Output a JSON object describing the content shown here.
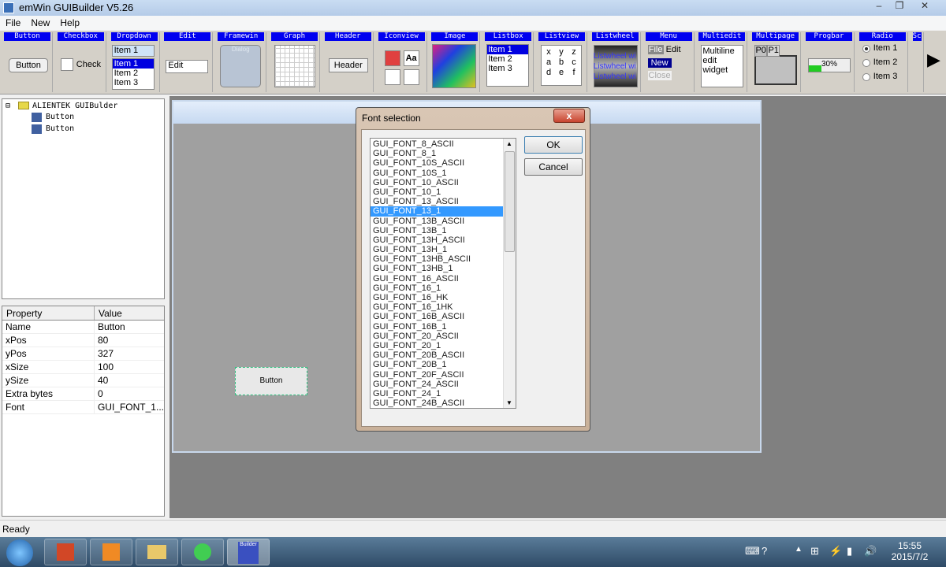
{
  "window": {
    "title": "emWin GUIBuilder V5.26",
    "minimize": "‒",
    "maximize": "❐",
    "close": "✕"
  },
  "menu": [
    "File",
    "New",
    "Help"
  ],
  "toolbar": {
    "tools": [
      "Button",
      "Checkbox",
      "Dropdown",
      "Edit",
      "Framewin",
      "Graph",
      "Header",
      "Iconview",
      "Image",
      "Listbox",
      "Listview",
      "Listwheel",
      "Menu",
      "Multiedit",
      "Multipage",
      "Progbar",
      "Radio",
      "Sc"
    ],
    "button_label": "Button",
    "check_label": "Check",
    "dropdown_selected": "Item 1",
    "dropdown_items": [
      "Item 1",
      "Item 2",
      "Item 3"
    ],
    "edit_value": "Edit",
    "framewin_title": "Dialog",
    "header_label": "Header",
    "iconview_text": "Aa",
    "listbox_items": [
      "Item 1",
      "Item 2",
      "Item 3"
    ],
    "listview_cells": [
      "x",
      "y",
      "z",
      "a",
      "b",
      "c",
      "d",
      "e",
      "f"
    ],
    "listwheel_items": [
      "Listwheel wi",
      "Listwheel wi",
      "Listwheel wi"
    ],
    "menu_items": [
      "File",
      "Edit",
      "New",
      "Close"
    ],
    "multiedit_lines": [
      "Multiline",
      "edit",
      "widget"
    ],
    "multipage_tabs": [
      "P0",
      "P1"
    ],
    "progbar_value": "30%",
    "progbar_percent": 30,
    "radio_items": [
      "Item 1",
      "Item 2",
      "Item 3"
    ],
    "radio_selected": 0,
    "more_arrow": "▶"
  },
  "tree": {
    "root": "ALIENTEK GUIBulder",
    "children": [
      "Button",
      "Button"
    ]
  },
  "properties": {
    "headers": [
      "Property",
      "Value"
    ],
    "rows": [
      [
        "Name",
        "Button"
      ],
      [
        "xPos",
        "80"
      ],
      [
        "yPos",
        "327"
      ],
      [
        "xSize",
        "100"
      ],
      [
        "ySize",
        "40"
      ],
      [
        "Extra bytes",
        "0"
      ],
      [
        "Font",
        "GUI_FONT_1..."
      ]
    ]
  },
  "design": {
    "button_label": "Button"
  },
  "dialog": {
    "title": "Font selection",
    "close": "x",
    "ok": "OK",
    "cancel": "Cancel",
    "selected_index": 7,
    "fonts": [
      "GUI_FONT_8_ASCII",
      "GUI_FONT_8_1",
      "GUI_FONT_10S_ASCII",
      "GUI_FONT_10S_1",
      "GUI_FONT_10_ASCII",
      "GUI_FONT_10_1",
      "GUI_FONT_13_ASCII",
      "GUI_FONT_13_1",
      "GUI_FONT_13B_ASCII",
      "GUI_FONT_13B_1",
      "GUI_FONT_13H_ASCII",
      "GUI_FONT_13H_1",
      "GUI_FONT_13HB_ASCII",
      "GUI_FONT_13HB_1",
      "GUI_FONT_16_ASCII",
      "GUI_FONT_16_1",
      "GUI_FONT_16_HK",
      "GUI_FONT_16_1HK",
      "GUI_FONT_16B_ASCII",
      "GUI_FONT_16B_1",
      "GUI_FONT_20_ASCII",
      "GUI_FONT_20_1",
      "GUI_FONT_20B_ASCII",
      "GUI_FONT_20B_1",
      "GUI_FONT_20F_ASCII",
      "GUI_FONT_24_ASCII",
      "GUI_FONT_24_1",
      "GUI_FONT_24B_ASCII"
    ]
  },
  "status": {
    "text": "Ready"
  },
  "taskbar": {
    "apps": [
      "start-orb",
      "powerpoint",
      "foxit-reader",
      "file-explorer",
      "qt-creator",
      "guibuilder"
    ],
    "active_app_label": "Builder",
    "time": "15:55",
    "date": "2015/7/2"
  }
}
